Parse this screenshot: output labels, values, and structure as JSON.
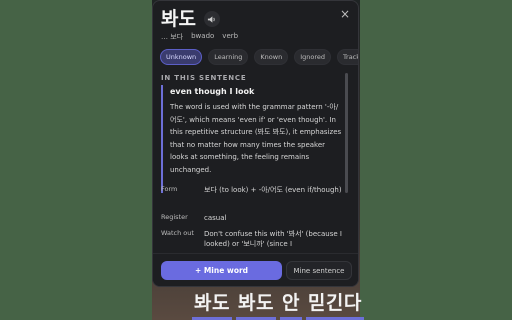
{
  "popup": {
    "word": "봐도",
    "speaker_icon": "speaker-icon",
    "close_icon": "close-icon",
    "close_glyph": "×",
    "meta": {
      "dictionary_form": "… 보다",
      "romanization": "bwado",
      "pos": "verb"
    },
    "tabs": [
      {
        "label": "Unknown",
        "active": true
      },
      {
        "label": "Learning",
        "active": false
      },
      {
        "label": "Known",
        "active": false
      },
      {
        "label": "Ignored",
        "active": false
      },
      {
        "label": "Tracked",
        "active": false
      }
    ],
    "section_heading": "IN THIS SENTENCE",
    "explanation_title": "even though I look",
    "explanation_body": "The word is used with the grammar pattern '-아/어도', which means 'even if' or 'even though'. In this repetitive structure (봐도 봐도), it emphasizes that no matter how many times the speaker looks at something, the feeling remains unchanged.",
    "fields": [
      {
        "label": "Form",
        "value": "보다 (to look) + -아/어도 (even if/though)"
      },
      {
        "label": "Register",
        "value": "casual"
      },
      {
        "label": "Watch out",
        "value": "Don't confuse this with '봐서' (because I looked) or '보니까' (since I"
      }
    ],
    "buttons": {
      "mine_word": "+ Mine word",
      "mine_sentence": "Mine sentence"
    }
  },
  "subtitle": {
    "words": [
      "봐도",
      "봐도",
      "안",
      "믿긴다"
    ]
  },
  "colors": {
    "accent": "#6a6be0",
    "panel_bg": "#1d1e21",
    "page_bg": "#466346"
  }
}
